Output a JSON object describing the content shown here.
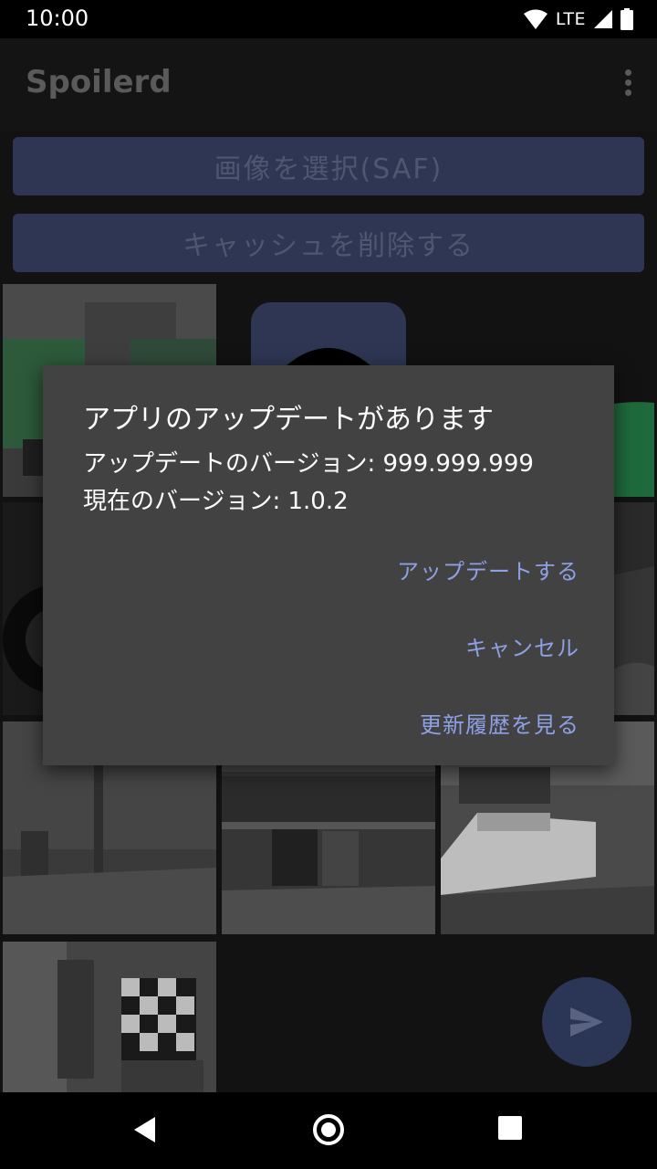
{
  "status_bar": {
    "time": "10:00",
    "network": "LTE",
    "icons": [
      "wifi-icon",
      "lte-signal-icon",
      "battery-icon"
    ]
  },
  "app_bar": {
    "title": "Spoilerd",
    "menu_icon": "more-vert-icon"
  },
  "buttons": {
    "select_image": "画像を選択(SAF)",
    "clear_cache": "キャッシュを削除する"
  },
  "gallery": {
    "thumbnails": [
      "thumbnail-1",
      "thumbnail-2",
      "thumbnail-3",
      "thumbnail-4",
      "thumbnail-5",
      "thumbnail-6",
      "thumbnail-7",
      "thumbnail-8",
      "thumbnail-9",
      "thumbnail-10"
    ]
  },
  "fab": {
    "icon": "send-icon"
  },
  "dialog": {
    "title": "アプリのアップデートがあります",
    "update_version_line": "アップデートのバージョン: 999.999.999",
    "current_version_line": "現在のバージョン: 1.0.2",
    "actions": {
      "update": "アップデートする",
      "cancel": "キャンセル",
      "changelog": "更新履歴を見る"
    }
  },
  "nav_bar": {
    "icons": [
      "back-icon",
      "home-icon",
      "recents-icon"
    ]
  },
  "colors": {
    "dialog_bg": "#424242",
    "accent": "#8ea0e6",
    "button_bg": "#2e3653",
    "fab_bg": "#2b3556"
  }
}
